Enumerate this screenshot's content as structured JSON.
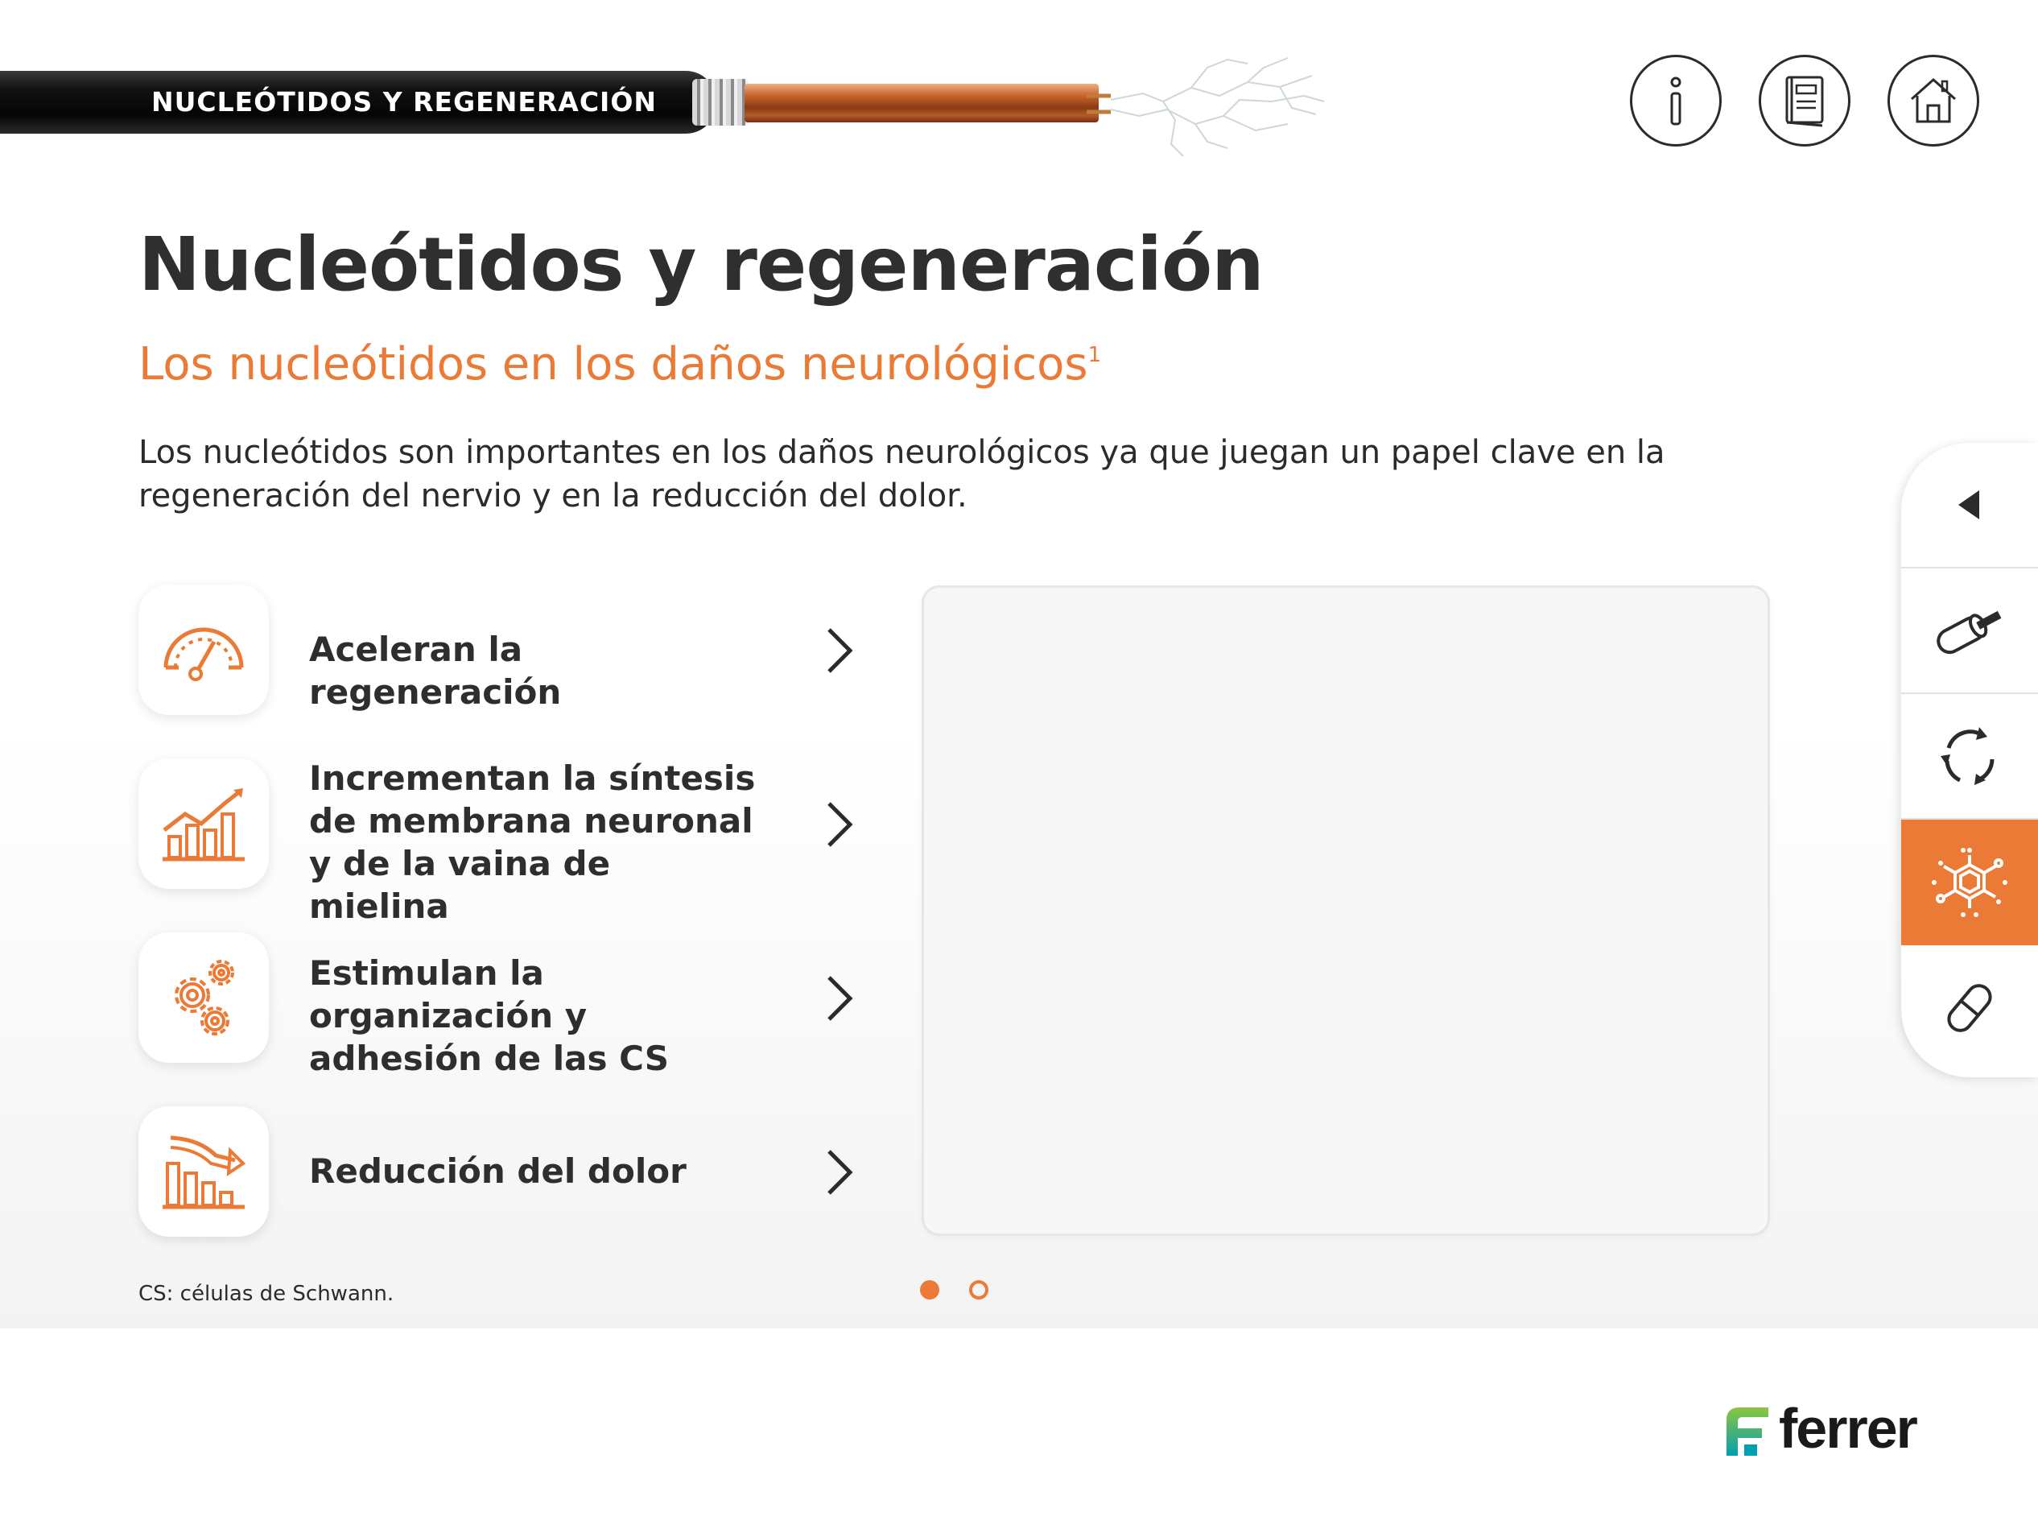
{
  "header": {
    "section_title": "NUCLEÓTIDOS Y REGENERACIÓN"
  },
  "top_nav": {
    "info_icon": "info-icon",
    "book_icon": "book-icon",
    "home_icon": "home-icon"
  },
  "main": {
    "title": "Nucleótidos y regeneración",
    "subtitle": "Los nucleótidos en los daños neurológicos",
    "subtitle_sup": "1",
    "intro": "Los nucleótidos son importantes en los daños neurológicos ya que juegan un papel clave en la regeneración del nervio y en la reducción del dolor."
  },
  "features": [
    {
      "label": "Aceleran la regeneración",
      "icon": "speedometer-icon"
    },
    {
      "label": "Incrementan la síntesis de membrana neuronal y de la vaina de mielina",
      "icon": "growth-chart-icon"
    },
    {
      "label": "Estimulan la organización y adhesión de las CS",
      "icon": "gears-icon"
    },
    {
      "label": "Reducción del dolor",
      "icon": "decline-chart-icon"
    }
  ],
  "footnote": "CS: células de Schwann.",
  "pagination": {
    "current": 1,
    "total": 2
  },
  "side_nav": {
    "items": [
      "collapse-arrow-icon",
      "cable-icon",
      "cycle-icon",
      "molecule-icon",
      "pill-icon"
    ],
    "active": "molecule-icon"
  },
  "brand": {
    "name": "ferrer",
    "accent_color": "#ea7a35"
  }
}
